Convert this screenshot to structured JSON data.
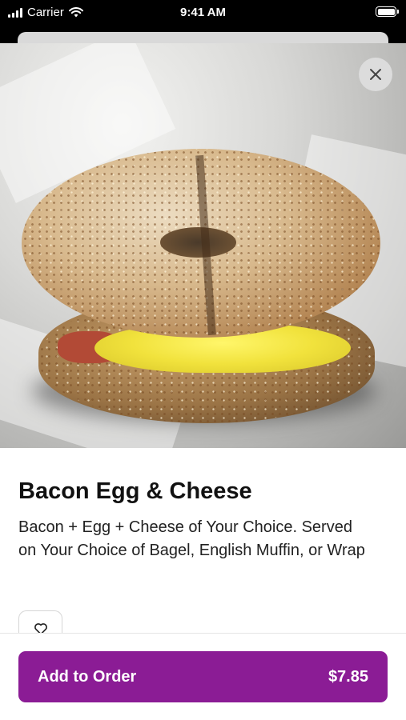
{
  "status_bar": {
    "carrier": "Carrier",
    "time": "9:41 AM"
  },
  "item": {
    "title": "Bacon Egg & Cheese",
    "description": "Bacon + Egg + Cheese of Your Choice. Served on Your Choice of Bagel, English Muffin, or Wrap"
  },
  "order": {
    "button_label": "Add to Order",
    "price": "$7.85"
  },
  "colors": {
    "accent": "#8b1c95"
  },
  "icons": {
    "close": "close-icon",
    "favorite": "heart-icon",
    "wifi": "wifi-icon",
    "battery": "battery-icon",
    "signal": "signal-icon"
  }
}
